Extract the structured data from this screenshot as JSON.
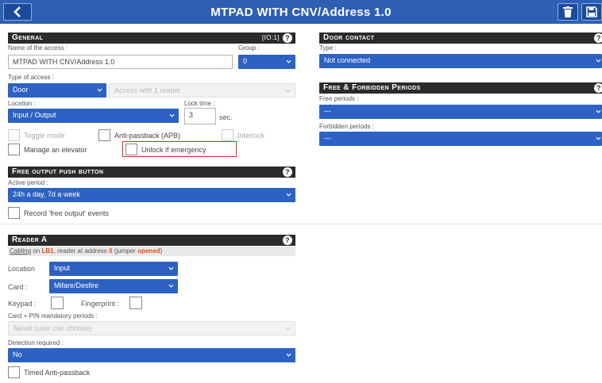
{
  "header": {
    "title": "MTPAD WITH CNV/Address 1.0"
  },
  "general": {
    "title": "General",
    "io_label": "[IO:1]",
    "help": "?",
    "name_label": "Name of the access :",
    "name_value": "MTPAD WITH CNV/Address 1.0",
    "group_label": "Group :",
    "group_value": "0",
    "type_label": "Type of access :",
    "type_value": "Door",
    "type_sub_value": "Access with 1 reader",
    "location_label": "Location :",
    "location_value": "Input / Output",
    "lock_time_label": "Lock time :",
    "lock_time_value": "3",
    "lock_time_unit": "sec.",
    "toggle_mode": "Toggle mode",
    "anti_passback": "Anti-passback (APB)",
    "interlock": "Interlock",
    "manage_elevator": "Manage an elevator",
    "unlock_emergency": "Unlock if emergency"
  },
  "free_output": {
    "title": "Free output push button",
    "help": "?",
    "active_period_label": "Active period :",
    "active_period_value": "24h a day, 7d a week",
    "record_events": "Record 'free output' events"
  },
  "reader_a": {
    "title": "Reader A",
    "help": "?",
    "cabling_link": "Cabling",
    "cabling_on": "on",
    "cabling_lb": "LB1",
    "cabling_mid": ", reader at address",
    "cabling_addr": "0",
    "cabling_jumper": "(jumper",
    "cabling_state": "opened",
    "cabling_end": ")",
    "location_label": "Location",
    "location_value": "Input",
    "card_label": "Card :",
    "card_value": "Mifare/Desfire",
    "keypad_label": "Keypad :",
    "fingerprint_label": "Fingerprint :",
    "pin_periods_label": "Card + PIN mandatory periods :",
    "pin_periods_value": "Never (user can choose)",
    "detection_label": "Detection required :",
    "detection_value": "No",
    "timed_apb": "Timed Anti-passback"
  },
  "door_contact": {
    "title": "Door contact",
    "help": "?",
    "type_label": "Type :",
    "type_value": "Not connected"
  },
  "periods": {
    "title": "Free & Forbidden Periods",
    "help": "?",
    "free_label": "Free periods :",
    "free_value": "---",
    "forbidden_label": "Forbidden periods :",
    "forbidden_value": "---"
  },
  "colors": {
    "header_bg": "#2d5fb4",
    "section_bg": "#2b2b2b",
    "select_bg": "#2d62c4",
    "highlight": "#d9302c",
    "accent_text": "#e04a1a"
  }
}
